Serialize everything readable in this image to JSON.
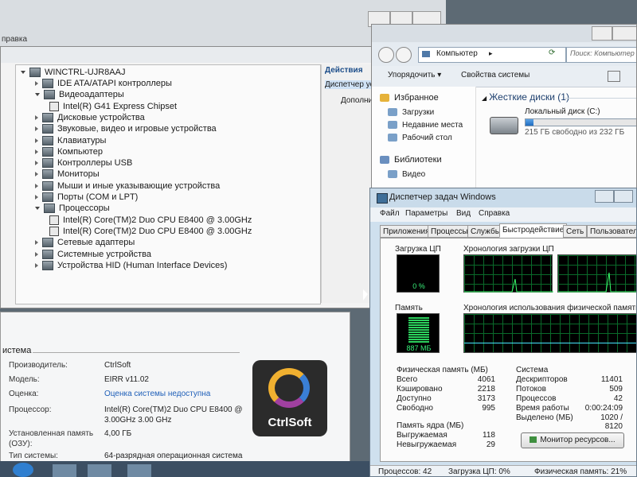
{
  "bg_window": {
    "title_fragment": "правка"
  },
  "device_manager": {
    "computer_name": "WINCTRL-UJR8AAJ",
    "items": [
      {
        "label": "IDE ATA/ATAPI контроллеры",
        "expanded": false,
        "indent": 1
      },
      {
        "label": "Видеоадаптеры",
        "expanded": true,
        "indent": 1
      },
      {
        "label": "Intel(R) G41 Express Chipset",
        "expanded": false,
        "indent": 2
      },
      {
        "label": "Дисковые устройства",
        "expanded": false,
        "indent": 1
      },
      {
        "label": "Звуковые, видео и игровые устройства",
        "expanded": false,
        "indent": 1
      },
      {
        "label": "Клавиатуры",
        "expanded": false,
        "indent": 1
      },
      {
        "label": "Компьютер",
        "expanded": false,
        "indent": 1
      },
      {
        "label": "Контроллеры USB",
        "expanded": false,
        "indent": 1
      },
      {
        "label": "Мониторы",
        "expanded": false,
        "indent": 1
      },
      {
        "label": "Мыши и иные указывающие устройства",
        "expanded": false,
        "indent": 1
      },
      {
        "label": "Порты (COM и LPT)",
        "expanded": false,
        "indent": 1
      },
      {
        "label": "Процессоры",
        "expanded": true,
        "indent": 1
      },
      {
        "label": "Intel(R) Core(TM)2 Duo CPU      E8400  @ 3.00GHz",
        "expanded": false,
        "indent": 2
      },
      {
        "label": "Intel(R) Core(TM)2 Duo CPU      E8400  @ 3.00GHz",
        "expanded": false,
        "indent": 2
      },
      {
        "label": "Сетевые адаптеры",
        "expanded": false,
        "indent": 1
      },
      {
        "label": "Системные устройства",
        "expanded": false,
        "indent": 1
      },
      {
        "label": "Устройства HID (Human Interface Devices)",
        "expanded": false,
        "indent": 1
      }
    ],
    "actions": {
      "header": "Действия",
      "item1": "Диспетчер ус",
      "item2": "Дополни"
    }
  },
  "system": {
    "section": "истема",
    "rows": [
      {
        "label": "Производитель:",
        "value": "CtrlSoft"
      },
      {
        "label": "Модель:",
        "value": "EIRR v11.02"
      },
      {
        "label": "Оценка:",
        "value": "Оценка системы недоступна",
        "link": true
      },
      {
        "label": "Процессор:",
        "value": "Intel(R) Core(TM)2 Duo CPU     E8400  @ 3.00GHz  3.00 GHz"
      },
      {
        "label": "Установленная память (ОЗУ):",
        "value": "4,00 ГБ"
      },
      {
        "label": "Тип системы:",
        "value": "64-разрядная операционная система"
      }
    ],
    "logo_text": "CtrlSoft"
  },
  "explorer": {
    "address": "Компьютер",
    "search_placeholder": "Поиск: Компьютер",
    "toolbar": {
      "organize": "Упорядочить",
      "properties": "Свойства системы"
    },
    "nav": [
      {
        "label": "Избранное",
        "group": true
      },
      {
        "label": "Загрузки",
        "group": false
      },
      {
        "label": "Недавние места",
        "group": false
      },
      {
        "label": "Рабочий стол",
        "group": false
      },
      {
        "label": "Библиотеки",
        "group": true
      },
      {
        "label": "Видео",
        "group": false
      }
    ],
    "section_title": "Жесткие диски (1)",
    "disk": {
      "name": "Локальный диск (C:)",
      "free": "215 ГБ свободно из 232 ГБ",
      "used_fraction": 0.07
    }
  },
  "taskmgr": {
    "title": "Диспетчер задач Windows",
    "menu": [
      "Файл",
      "Параметры",
      "Вид",
      "Справка"
    ],
    "tabs": [
      "Приложения",
      "Процессы",
      "Службы",
      "Быстродействие",
      "Сеть",
      "Пользователи"
    ],
    "active_tab": 3,
    "cpu_label": "Загрузка ЦП",
    "cpu_value": "0 %",
    "cpu_history_label": "Хронология загрузки ЦП",
    "mem_label": "Память",
    "mem_value": "887 МБ",
    "mem_history_label": "Хронология использования физической памяти",
    "phys": {
      "title": "Физическая память (МБ)",
      "rows": [
        {
          "label": "Всего",
          "value": "4061"
        },
        {
          "label": "Кэшировано",
          "value": "2218"
        },
        {
          "label": "Доступно",
          "value": "3173"
        },
        {
          "label": "Свободно",
          "value": "995"
        }
      ]
    },
    "kernel": {
      "title": "Память ядра (МБ)",
      "rows": [
        {
          "label": "Выгружаемая",
          "value": "118"
        },
        {
          "label": "Невыгружаемая",
          "value": "29"
        }
      ]
    },
    "sys": {
      "title": "Система",
      "rows": [
        {
          "label": "Дескрипторов",
          "value": "11401"
        },
        {
          "label": "Потоков",
          "value": "509"
        },
        {
          "label": "Процессов",
          "value": "42"
        },
        {
          "label": "Время работы",
          "value": "0:00:24:09"
        },
        {
          "label": "Выделено (МБ)",
          "value": "1020 / 8120"
        }
      ]
    },
    "resmon_button": "Монитор ресурсов...",
    "status": {
      "processes": "Процессов: 42",
      "cpu": "Загрузка ЦП: 0%",
      "mem": "Физическая память: 21%"
    }
  }
}
